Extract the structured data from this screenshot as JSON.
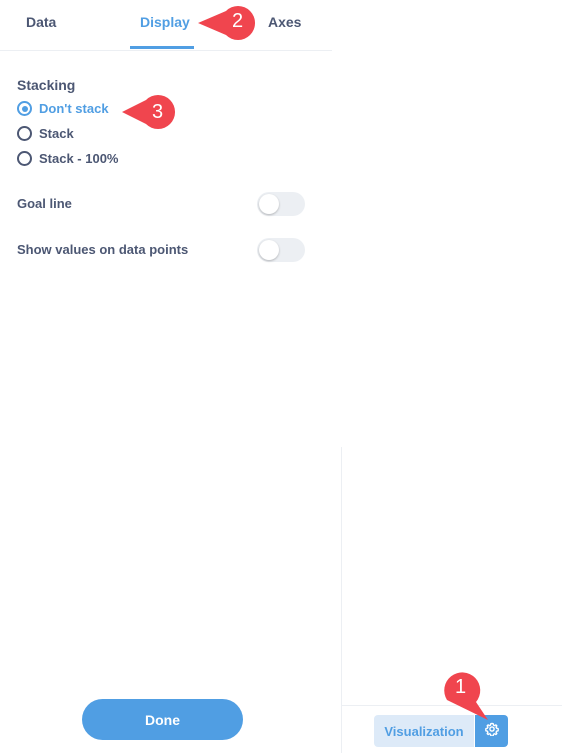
{
  "tabs": [
    {
      "label": "Data",
      "active": false
    },
    {
      "label": "Display",
      "active": true
    },
    {
      "label": "Axes",
      "active": false
    }
  ],
  "stacking": {
    "title": "Stacking",
    "options": [
      {
        "label": "Don't stack",
        "checked": true
      },
      {
        "label": "Stack",
        "checked": false
      },
      {
        "label": "Stack - 100%",
        "checked": false
      }
    ]
  },
  "settings": [
    {
      "label": "Goal line",
      "enabled": false
    },
    {
      "label": "Show values on data points",
      "enabled": false
    }
  ],
  "done_label": "Done",
  "footer": {
    "visualization_label": "Visualization",
    "settings_icon": "gear-icon"
  },
  "annotations": [
    {
      "number": "1"
    },
    {
      "number": "2"
    },
    {
      "number": "3"
    }
  ],
  "colors": {
    "accent": "#509ee3",
    "text": "#4c5773",
    "callout": "#f0454e"
  }
}
